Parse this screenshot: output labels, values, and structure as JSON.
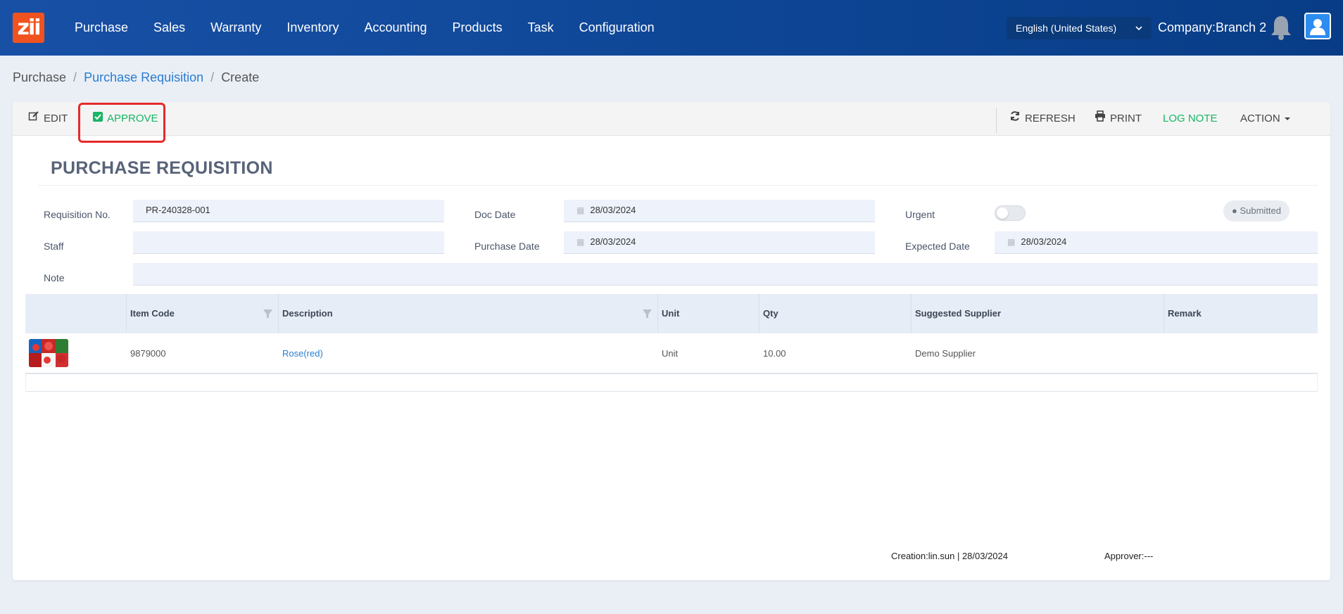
{
  "app": {
    "logo_text": "zii",
    "brand_color": "#f0531f"
  },
  "nav": {
    "menu": [
      "Purchase",
      "Sales",
      "Warranty",
      "Inventory",
      "Accounting",
      "Products",
      "Task",
      "Configuration"
    ],
    "language": "English (United States)",
    "company": "Company:Branch 2"
  },
  "breadcrumb": {
    "root": "Purchase",
    "section": "Purchase Requisition",
    "current": "Create",
    "sep": "/"
  },
  "toolbar": {
    "edit": "EDIT",
    "approve": "APPROVE",
    "refresh": "REFRESH",
    "print": "PRINT",
    "log_note": "LOG NOTE",
    "action": "ACTION"
  },
  "form": {
    "title": "PURCHASE REQUISITION",
    "requisition_no_label": "Requisition No.",
    "requisition_no": "PR-240328-001",
    "staff_label": "Staff",
    "staff": "",
    "note_label": "Note",
    "note": "",
    "doc_date_label": "Doc Date",
    "doc_date": "28/03/2024",
    "purchase_date_label": "Purchase Date",
    "purchase_date": "28/03/2024",
    "urgent_label": "Urgent",
    "urgent": false,
    "expected_date_label": "Expected Date",
    "expected_date": "28/03/2024",
    "status": "Submitted"
  },
  "table": {
    "headers": [
      "",
      "Item Code",
      "Description",
      "Unit",
      "Qty",
      "Suggested Supplier",
      "Remark"
    ],
    "rows": [
      {
        "item_code": "9879000",
        "description": "Rose(red)",
        "unit": "Unit",
        "qty": "10.00",
        "supplier": "Demo Supplier",
        "remark": ""
      }
    ]
  },
  "footer": {
    "creation": "Creation:lin.sun | 28/03/2024",
    "approver": "Approver:---"
  },
  "colors": {
    "nav_bg": "#0d4594",
    "accent_green": "#18b565",
    "link_blue": "#2a7dd0",
    "highlight_red": "#e52a2a"
  }
}
